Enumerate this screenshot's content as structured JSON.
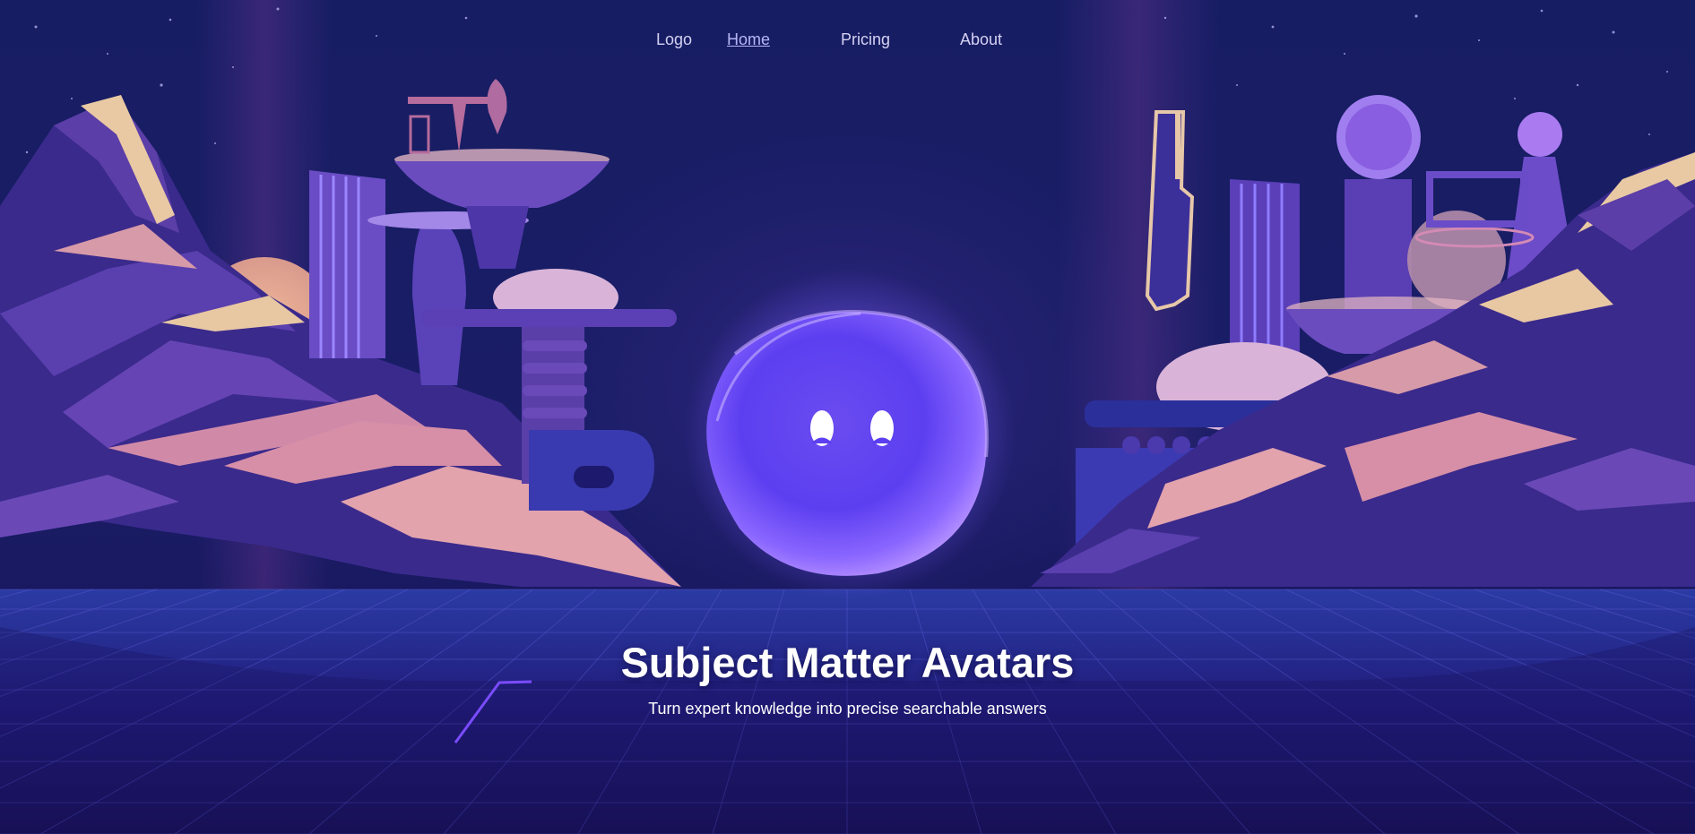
{
  "nav": {
    "logo": "Logo",
    "items": [
      {
        "label": "Home",
        "active": true
      },
      {
        "label": "Pricing",
        "active": false
      },
      {
        "label": "About",
        "active": false
      }
    ]
  },
  "hero": {
    "title": "Subject Matter Avatars",
    "subtitle": "Turn expert knowledge into precise searchable answers"
  },
  "colors": {
    "background": "#140f4a",
    "accent": "#7b5cff",
    "highlight": "#e6c7a8",
    "text": "#ffffff"
  },
  "illustration": {
    "subject": "purple-orb-avatar",
    "setting": "synthwave-alien-city"
  }
}
